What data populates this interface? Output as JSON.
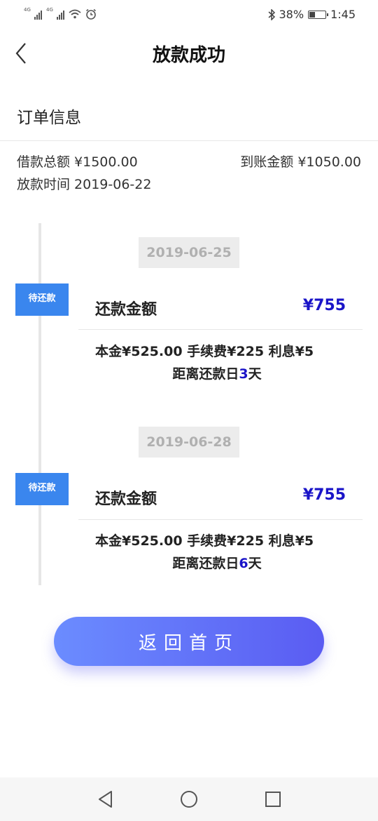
{
  "status_bar": {
    "left_icons": [
      "signal-4g-icon",
      "signal-4g-icon",
      "wifi-icon",
      "alarm-icon"
    ],
    "signal_tag": "4G",
    "right_icons": [
      "bluetooth-icon",
      "battery-icon"
    ],
    "battery": "38%",
    "battery_level": 0.38,
    "time": "1:45"
  },
  "header": {
    "back_icon": "back-chevron-icon",
    "title": "放款成功"
  },
  "order": {
    "section_title": "订单信息",
    "loan_total": "借款总额 ¥1500.00",
    "received_amount": "到账金额 ¥1050.00",
    "loan_time": "放款时间 2019-06-22"
  },
  "repayments": [
    {
      "date": "2019-06-25",
      "status": "待还款",
      "amount_label": "还款金额",
      "amount": "¥755",
      "fee_line": "本金¥525.00 手续费¥225 利息¥5",
      "days_prefix": "距离还款日",
      "days_num": "3",
      "days_suffix": "天"
    },
    {
      "date": "2019-06-28",
      "status": "待还款",
      "amount_label": "还款金额",
      "amount": "¥755",
      "fee_line": "本金¥525.00 手续费¥225 利息¥5",
      "days_prefix": "距离还款日",
      "days_num": "6",
      "days_suffix": "天"
    }
  ],
  "button": {
    "label": "返回首页"
  },
  "nav_bar": {
    "icons": [
      "nav-back-icon",
      "nav-home-icon",
      "nav-recents-icon"
    ]
  },
  "colors": {
    "accent_blue": "#3a86ee",
    "amount_blue": "#1a14c8",
    "button_start": "#6b8cff",
    "button_end": "#5a5cf2"
  }
}
